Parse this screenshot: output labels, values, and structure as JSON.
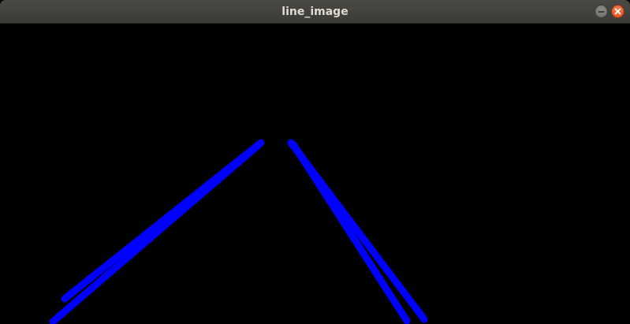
{
  "window": {
    "title": "line_image"
  },
  "image": {
    "background_color": "#000000",
    "line_color": "#0000ff"
  },
  "controls": {
    "minimize_icon": "minimize-icon",
    "close_icon": "close-icon"
  }
}
